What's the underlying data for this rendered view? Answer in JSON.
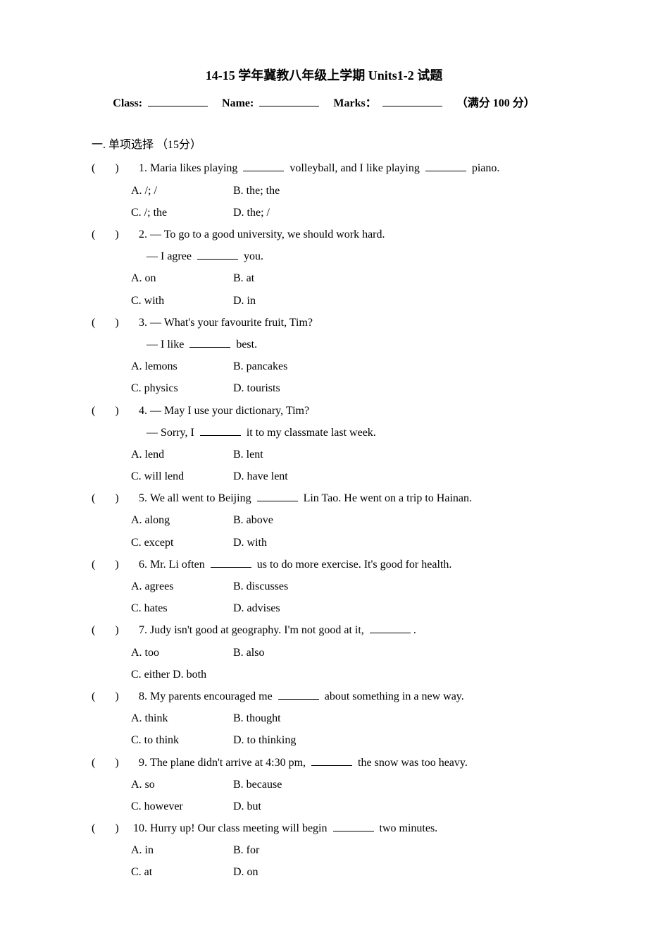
{
  "title": "14-15 学年冀教八年级上学期 Units1-2 试题",
  "info_line": {
    "class_label": "Class:",
    "name_label": "Name:",
    "marks_label": "Marks：",
    "full_marks": "（满分 100 分）"
  },
  "section1": {
    "header": "一. 单项选择 （15分）"
  },
  "questions": [
    {
      "num": "1.",
      "text_pre": "Maria likes playing ",
      "text_mid": " volleyball, and I like playing ",
      "text_post": " piano.",
      "choices": [
        [
          "A. /; /",
          "B. the; the"
        ],
        [
          "C. /; the",
          "D. the; /"
        ]
      ]
    },
    {
      "num": "2.",
      "line1": "— To go to a good university, we should work hard.",
      "line2_pre": "— I agree ",
      "line2_post": " you.",
      "choices": [
        [
          "A. on",
          "B. at"
        ],
        [
          "C. with",
          "D. in"
        ]
      ]
    },
    {
      "num": "3.",
      "line1": "— What's your favourite fruit, Tim?",
      "line2_pre": "— I like ",
      "line2_post": " best.",
      "choices": [
        [
          "A. lemons",
          "B. pancakes"
        ],
        [
          "C. physics",
          "D. tourists"
        ]
      ]
    },
    {
      "num": "4.",
      "line1": "— May I use your dictionary, Tim?",
      "line2_pre": "— Sorry, I ",
      "line2_post": " it to my classmate last week.",
      "choices": [
        [
          "A. lend",
          "B. lent"
        ],
        [
          "C. will lend",
          "D. have lent"
        ]
      ]
    },
    {
      "num": "5.",
      "text_pre": "We all went to Beijing ",
      "text_post": " Lin Tao. He went on a trip to Hainan.",
      "choices": [
        [
          "A. along",
          "B. above"
        ],
        [
          "C. except",
          "D. with"
        ]
      ]
    },
    {
      "num": "6.",
      "text_pre": "Mr. Li often ",
      "text_post": " us to do more exercise. It's good for health.",
      "choices": [
        [
          "A. agrees",
          "B. discusses"
        ],
        [
          "C. hates",
          "D. advises"
        ]
      ]
    },
    {
      "num": "7.",
      "text_pre": "Judy isn't good at geography. I'm not good at it, ",
      "text_post": ".",
      "choices_mixed": {
        "row1": [
          "A. too",
          "B. also"
        ],
        "row2_single": "C. either D. both"
      }
    },
    {
      "num": "8.",
      "text_pre": "My parents encouraged me ",
      "text_post": " about something in a new way.",
      "choices": [
        [
          "A. think",
          "B. thought"
        ],
        [
          "C. to think",
          "D. to thinking"
        ]
      ]
    },
    {
      "num": "9.",
      "text_pre": "The plane didn't arrive at 4:30 pm, ",
      "text_post": " the snow was too heavy.",
      "choices": [
        [
          "A. so",
          "B. because"
        ],
        [
          "C. however",
          "D. but"
        ]
      ]
    },
    {
      "num": "10.",
      "text_pre": "Hurry up! Our class meeting will begin ",
      "text_post": " two minutes.",
      "choices": [
        [
          "A. in",
          "B. for"
        ],
        [
          "C. at",
          "D. on"
        ]
      ]
    }
  ]
}
